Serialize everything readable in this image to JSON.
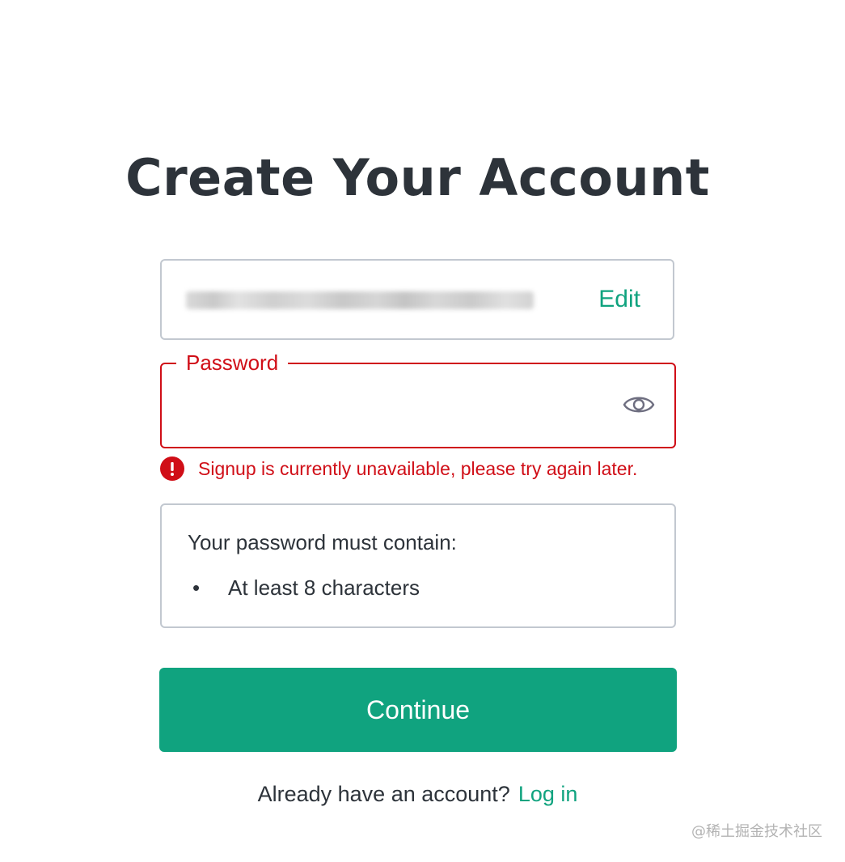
{
  "page": {
    "title": "Create Your Account"
  },
  "email": {
    "value_state": "blurred",
    "edit_label": "Edit"
  },
  "password": {
    "label": "Password",
    "value": "",
    "visibility_icon": "eye-icon"
  },
  "error": {
    "icon": "exclamation-circle-icon",
    "message": "Signup is currently unavailable, please try again later."
  },
  "requirements": {
    "title": "Your password must contain:",
    "bullet": "•",
    "items": [
      "At least 8 characters"
    ]
  },
  "actions": {
    "continue_label": "Continue"
  },
  "login": {
    "prompt": "Already have an account?",
    "link_label": "Log in"
  },
  "watermark": {
    "text": "@稀土掘金技术社区"
  },
  "colors": {
    "accent": "#10a37f",
    "error": "#d00e17",
    "text": "#2d333a",
    "border": "#c2c8d0"
  }
}
